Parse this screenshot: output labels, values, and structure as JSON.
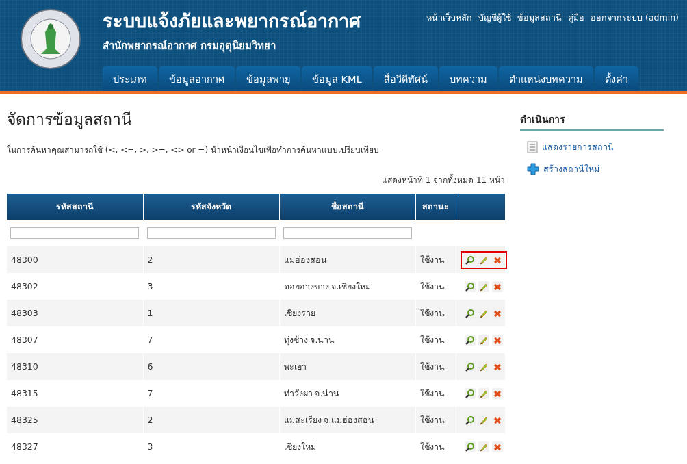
{
  "header": {
    "title": "ระบบแจ้งภัยและพยากรณ์อากาศ",
    "subtitle": "สำนักพยากรณ์อากาศ กรมอุตุนิยมวิทยา",
    "top_links": [
      "หน้าเว็บหลัก",
      "บัญชีผู้ใช้",
      "ข้อมูลสถานี",
      "คู่มือ",
      "ออกจากระบบ (admin)"
    ],
    "tabs": [
      "ประเภท",
      "ข้อมูลอากาศ",
      "ข้อมูลพายุ",
      "ข้อมูล KML",
      "สื่อวีดีทัศน์",
      "บทความ",
      "ตำแหน่งบทความ",
      "ตั้งค่า"
    ]
  },
  "page": {
    "title": "จัดการข้อมูลสถานี",
    "hint": "ในการค้นหาคุณสามารถใช้ (<, <=, >, >=, <> or =) นำหน้าเงื่อนไขเพื่อทำการค้นหาแบบเปรียบเทียบ",
    "pager": "แสดงหน้าที่ 1 จากทั้งหมด 11 หน้า"
  },
  "table": {
    "columns": [
      "รหัสสถานี",
      "รหัสจังหวัด",
      "ชื่อสถานี",
      "สถานะ"
    ],
    "rows": [
      {
        "cells": [
          "48300",
          "2",
          "แม่ฮ่องสอน",
          "ใช้งาน"
        ],
        "highlighted": true
      },
      {
        "cells": [
          "48302",
          "3",
          "ดอยอ่างขาง จ.เชียงใหม่",
          "ใช้งาน"
        ],
        "highlighted": false
      },
      {
        "cells": [
          "48303",
          "1",
          "เชียงราย",
          "ใช้งาน"
        ],
        "highlighted": false
      },
      {
        "cells": [
          "48307",
          "7",
          "ทุ่งช้าง จ.น่าน",
          "ใช้งาน"
        ],
        "highlighted": false
      },
      {
        "cells": [
          "48310",
          "6",
          "พะเยา",
          "ใช้งาน"
        ],
        "highlighted": false
      },
      {
        "cells": [
          "48315",
          "7",
          "ท่าวังผา จ.น่าน",
          "ใช้งาน"
        ],
        "highlighted": false
      },
      {
        "cells": [
          "48325",
          "2",
          "แม่สะเรียง จ.แม่ฮ่องสอน",
          "ใช้งาน"
        ],
        "highlighted": false
      },
      {
        "cells": [
          "48327",
          "3",
          "เชียงใหม่",
          "ใช้งาน"
        ],
        "highlighted": false
      }
    ]
  },
  "sidebar": {
    "title": "ดำเนินการ",
    "links": [
      {
        "kind": "list",
        "label": "แสดงรายการสถานี"
      },
      {
        "kind": "create",
        "label": "สร้างสถานีใหม่"
      }
    ]
  }
}
